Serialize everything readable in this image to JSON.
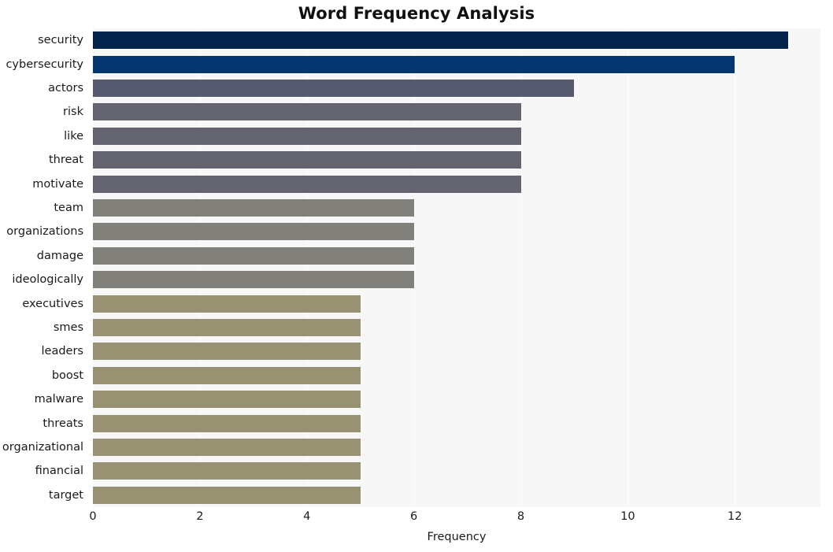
{
  "chart_data": {
    "type": "bar",
    "orientation": "horizontal",
    "title": "Word Frequency Analysis",
    "xlabel": "Frequency",
    "ylabel": "",
    "xlim": [
      0,
      13.6
    ],
    "ylim": [
      0,
      20
    ],
    "grid": true,
    "legend": null,
    "xticks": [
      "0",
      "2",
      "4",
      "6",
      "8",
      "10",
      "12"
    ],
    "xtick_values": [
      0,
      2,
      4,
      6,
      8,
      10,
      12
    ],
    "categories": [
      "security",
      "cybersecurity",
      "actors",
      "risk",
      "like",
      "threat",
      "motivate",
      "team",
      "organizations",
      "damage",
      "ideologically",
      "executives",
      "smes",
      "leaders",
      "boost",
      "malware",
      "threats",
      "organizational",
      "financial",
      "target"
    ],
    "values": [
      13,
      12,
      9,
      8,
      8,
      8,
      8,
      6,
      6,
      6,
      6,
      5,
      5,
      5,
      5,
      5,
      5,
      5,
      5,
      5
    ],
    "bar_colors": [
      "#04234a",
      "#063672",
      "#555a70",
      "#63646f",
      "#63646f",
      "#63646f",
      "#63646f",
      "#82807a",
      "#82807a",
      "#82807a",
      "#82807a",
      "#989272",
      "#989272",
      "#989272",
      "#989272",
      "#989272",
      "#989272",
      "#989272",
      "#989272",
      "#989272"
    ]
  },
  "style": {
    "plot_background": "#f7f7f7",
    "figure_background": "#ffffff",
    "gridline_color": "#ffffff",
    "text_color": "#1a1a1a"
  }
}
